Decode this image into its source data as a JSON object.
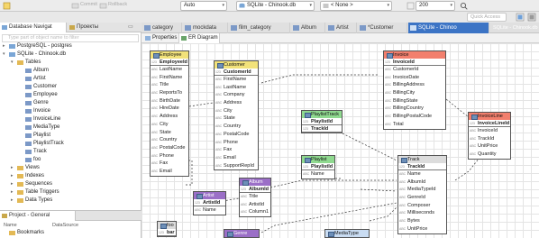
{
  "toolbar": {
    "commit_label": "Commit",
    "rollback_label": "Rollback",
    "transaction_mode": "Auto",
    "active_datasource": "SQLite - Chinook.db",
    "active_schema": "< None >",
    "result_limit": "200",
    "quick_access_placeholder": "Quick Access"
  },
  "navigator": {
    "tabs": [
      {
        "label": "Database Navigat",
        "active": true
      },
      {
        "label": "Проекты",
        "active": false
      }
    ],
    "filter_placeholder": "Type part of object name to filter",
    "tree": [
      {
        "label": "PostgreSQL - postgres",
        "level": 0,
        "expanded": false,
        "icon": "database-icon"
      },
      {
        "label": "SQLite - Chinook.db",
        "level": 0,
        "expanded": true,
        "icon": "database-icon"
      },
      {
        "label": "Tables",
        "level": 1,
        "expanded": true,
        "icon": "folder-icon"
      },
      {
        "label": "Album",
        "level": 2,
        "icon": "table-icon"
      },
      {
        "label": "Artist",
        "level": 2,
        "icon": "table-icon"
      },
      {
        "label": "Customer",
        "level": 2,
        "icon": "table-icon"
      },
      {
        "label": "Employee",
        "level": 2,
        "icon": "table-icon"
      },
      {
        "label": "Genre",
        "level": 2,
        "icon": "table-icon"
      },
      {
        "label": "Invoice",
        "level": 2,
        "icon": "table-icon"
      },
      {
        "label": "InvoiceLine",
        "level": 2,
        "icon": "table-icon"
      },
      {
        "label": "MediaType",
        "level": 2,
        "icon": "table-icon"
      },
      {
        "label": "Playlist",
        "level": 2,
        "icon": "table-icon"
      },
      {
        "label": "PlaylistTrack",
        "level": 2,
        "icon": "table-icon"
      },
      {
        "label": "Track",
        "level": 2,
        "icon": "table-icon"
      },
      {
        "label": "foo",
        "level": 2,
        "icon": "table-icon"
      },
      {
        "label": "Views",
        "level": 1,
        "expanded": false,
        "icon": "folder-icon"
      },
      {
        "label": "Indexes",
        "level": 1,
        "expanded": false,
        "icon": "folder-icon"
      },
      {
        "label": "Sequences",
        "level": 1,
        "expanded": false,
        "icon": "folder-icon"
      },
      {
        "label": "Table Triggers",
        "level": 1,
        "expanded": false,
        "icon": "folder-icon"
      },
      {
        "label": "Data Types",
        "level": 1,
        "expanded": false,
        "icon": "folder-icon"
      }
    ]
  },
  "project": {
    "title": "Project - General",
    "columns": [
      "Name",
      "DataSource"
    ],
    "items": [
      {
        "label": "Bookmarks"
      }
    ]
  },
  "editor": {
    "tabs": [
      {
        "label": "category",
        "active": false
      },
      {
        "label": "mockdata",
        "active": false
      },
      {
        "label": "film_category",
        "active": false
      },
      {
        "label": "Album",
        "active": false
      },
      {
        "label": "Artist",
        "active": false
      },
      {
        "label": "*Customer",
        "active": false
      },
      {
        "label": "SQLite - Chinoo",
        "active": true
      }
    ],
    "active_tab_path": "SQLite - Chinook.db",
    "sub_tabs": [
      {
        "label": "Properties",
        "active": false
      },
      {
        "label": "ER Diagram",
        "active": true
      }
    ]
  },
  "colors": {
    "yellow_header": "#f2e27a",
    "red_header": "#f27f6d",
    "green_header": "#8fd98f",
    "purple_header": "#9b6fc7",
    "active_tab": "#3c74c5"
  },
  "diagram": {
    "entities": [
      {
        "id": "employee",
        "name": "Employee",
        "color": "yellow",
        "key": "EmployeeId",
        "attributes": [
          "LastName",
          "FirstName",
          "Title",
          "ReportsTo",
          "BirthDate",
          "HireDate",
          "Address",
          "City",
          "State",
          "Country",
          "PostalCode",
          "Phone",
          "Fax",
          "Email"
        ]
      },
      {
        "id": "customer",
        "name": "Customer",
        "color": "yellow",
        "key": "CustomerId",
        "attributes": [
          "FirstName",
          "LastName",
          "Company",
          "Address",
          "City",
          "State",
          "Country",
          "PostalCode",
          "Phone",
          "Fax",
          "Email",
          "SupportRepId"
        ]
      },
      {
        "id": "invoice",
        "name": "Invoice",
        "color": "red",
        "key": "InvoiceId",
        "attributes": [
          "CustomerId",
          "InvoiceDate",
          "BillingAddress",
          "BillingCity",
          "BillingState",
          "BillingCountry",
          "BillingPostalCode",
          "Total"
        ]
      },
      {
        "id": "invoiceline",
        "name": "InvoiceLine",
        "color": "red",
        "key": "InvoiceLineId",
        "attributes": [
          "InvoiceId",
          "TrackId",
          "UnitPrice",
          "Quantity"
        ]
      },
      {
        "id": "playlisttrack",
        "name": "PlaylistTrack",
        "color": "green",
        "key": "PlaylistId",
        "key2": "TrackId",
        "attributes": []
      },
      {
        "id": "playlist",
        "name": "Playlist",
        "color": "green",
        "key": "PlaylistId",
        "attributes": [
          "Name"
        ]
      },
      {
        "id": "track",
        "name": "Track",
        "color": "gray",
        "key": "TrackId",
        "attributes": [
          "Name",
          "AlbumId",
          "MediaTypeId",
          "GenreId",
          "Composer",
          "Milliseconds",
          "Bytes",
          "UnitPrice"
        ]
      },
      {
        "id": "album",
        "name": "Album",
        "color": "purple",
        "key": "AlbumId",
        "attributes": [
          "Title",
          "ArtistId",
          "Column1"
        ]
      },
      {
        "id": "artist",
        "name": "Artist",
        "color": "purple",
        "key": "ArtistId",
        "attributes": [
          "Name"
        ]
      },
      {
        "id": "foo",
        "name": "foo",
        "color": "gray",
        "key": "bar",
        "attributes": []
      },
      {
        "id": "genre",
        "name": "Genre",
        "color": "purple",
        "key": "",
        "attributes": []
      },
      {
        "id": "mediatype",
        "name": "MediaType",
        "color": "blue",
        "key": "",
        "attributes": []
      }
    ]
  }
}
